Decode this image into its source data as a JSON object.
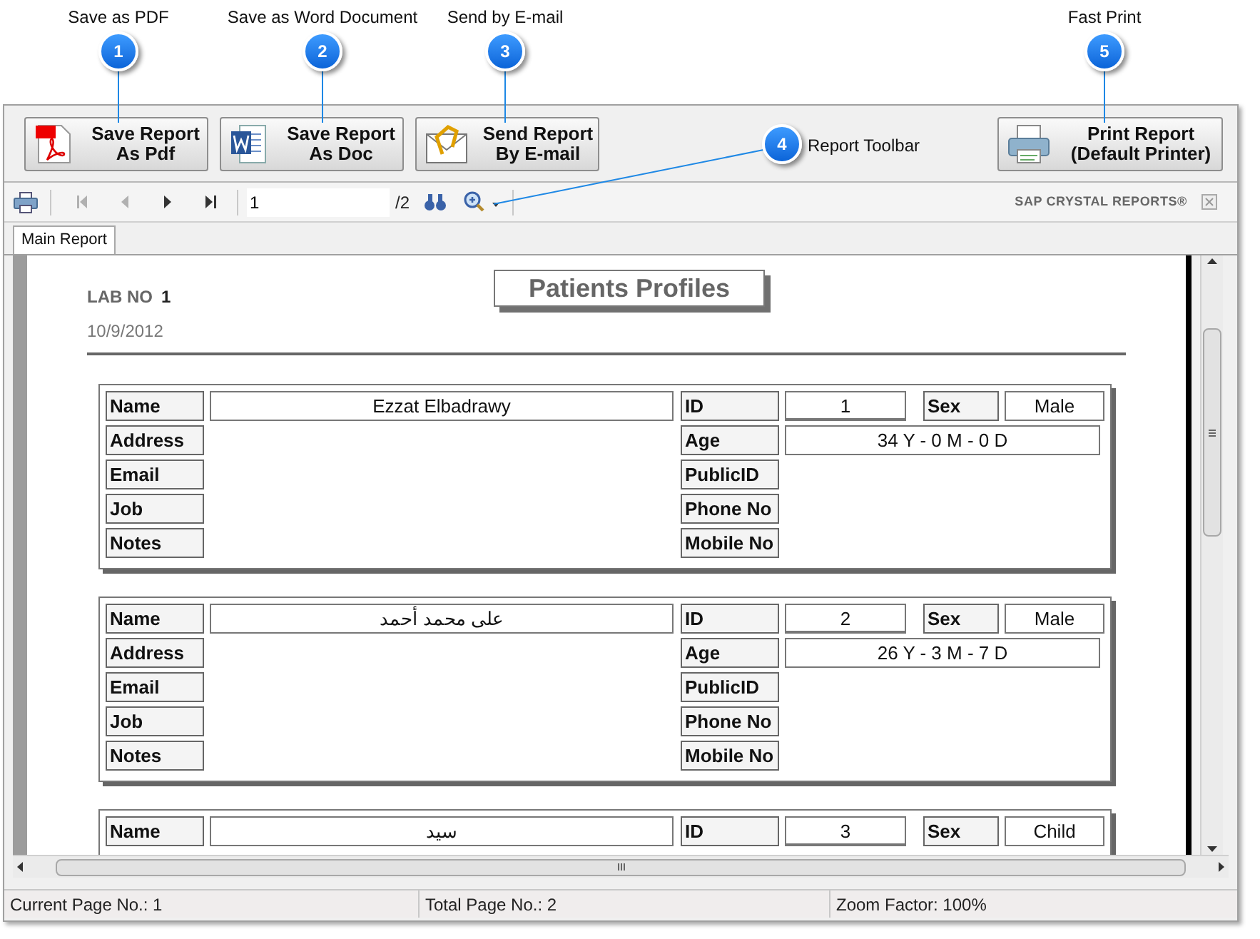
{
  "callouts": [
    {
      "number": "1",
      "label": "Save as PDF"
    },
    {
      "number": "2",
      "label": "Save as Word Document"
    },
    {
      "number": "3",
      "label": "Send by E-mail"
    },
    {
      "number": "4",
      "label": "Report Toolbar"
    },
    {
      "number": "5",
      "label": "Fast Print"
    }
  ],
  "buttons": [
    {
      "kind": "pdf",
      "line1": "Save Report",
      "line2": "As Pdf"
    },
    {
      "kind": "doc",
      "line1": "Save Report",
      "line2": "As Doc"
    },
    {
      "kind": "email",
      "line1": "Send Report",
      "line2": "By E-mail"
    },
    {
      "kind": "print",
      "line1": "Print Report",
      "line2": "(Default Printer)"
    }
  ],
  "toolbar": {
    "nav": [
      {
        "kind": "first",
        "disabled": true
      },
      {
        "kind": "prev",
        "disabled": true
      },
      {
        "kind": "next",
        "disabled": false
      },
      {
        "kind": "last",
        "disabled": false
      }
    ],
    "page": "1",
    "total": "/2",
    "brand": "SAP CRYSTAL REPORTS®"
  },
  "tabs": [
    {
      "label": "Main Report",
      "selected": true
    }
  ],
  "report": {
    "lab_label": "LAB NO",
    "lab_value": "1",
    "date": "10/9/2012",
    "title": "Patients Profiles",
    "records": [
      {
        "left": [
          {
            "label": "Name",
            "value": "Ezzat Elbadrawy"
          },
          {
            "label": "Address"
          },
          {
            "label": "Email"
          },
          {
            "label": "Job"
          },
          {
            "label": "Notes"
          }
        ],
        "right": [
          {
            "label": "ID",
            "value": "1",
            "extra_label": "Sex",
            "extra_value": "Male"
          },
          {
            "label": "Age",
            "value": "34 Y - 0 M - 0 D"
          },
          {
            "label": "PublicID"
          },
          {
            "label": "Phone No"
          },
          {
            "label": "Mobile No"
          }
        ]
      },
      {
        "left": [
          {
            "label": "Name",
            "value": "على محمد أحمد"
          },
          {
            "label": "Address"
          },
          {
            "label": "Email"
          },
          {
            "label": "Job"
          },
          {
            "label": "Notes"
          }
        ],
        "right": [
          {
            "label": "ID",
            "value": "2",
            "extra_label": "Sex",
            "extra_value": "Male"
          },
          {
            "label": "Age",
            "value": "26 Y - 3 M - 7 D"
          },
          {
            "label": "PublicID"
          },
          {
            "label": "Phone No"
          },
          {
            "label": "Mobile No"
          }
        ]
      },
      {
        "left": [
          {
            "label": "Name",
            "value": "سيد"
          }
        ],
        "right": [
          {
            "label": "ID",
            "value": "3",
            "extra_label": "Sex",
            "extra_value": "Child"
          }
        ]
      }
    ]
  },
  "status_bar": [
    "Current Page No.: 1",
    "Total Page No.: 2",
    "Zoom Factor: 100%"
  ]
}
